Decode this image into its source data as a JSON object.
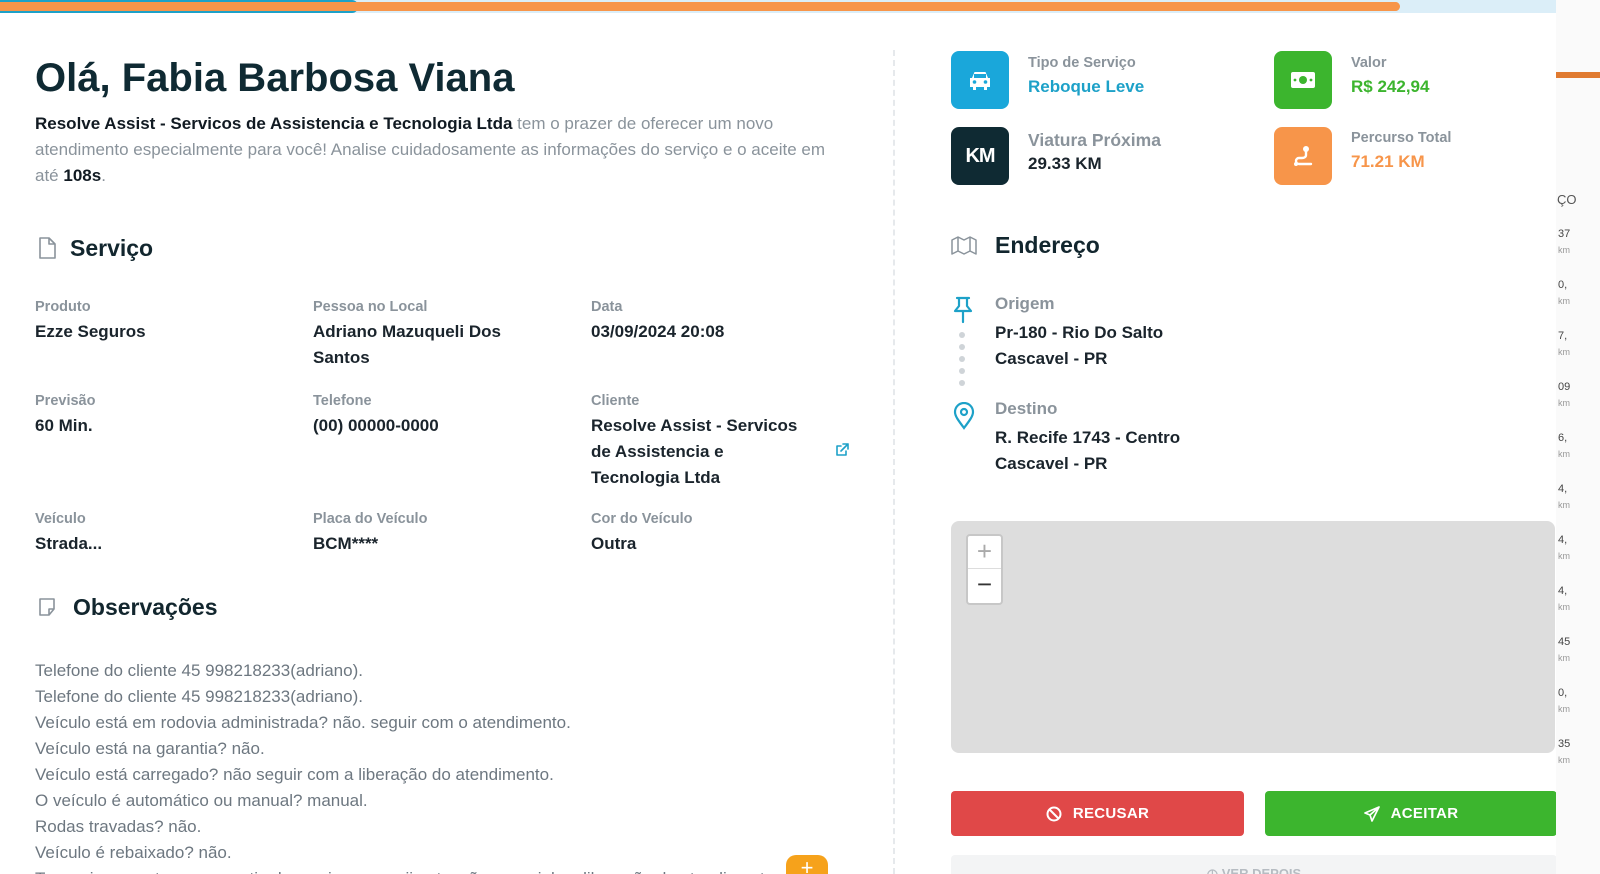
{
  "colors": {
    "accent_blue": "#1da1c8",
    "accent_orange": "#f7954a",
    "accent_green": "#3cb52e",
    "accent_red": "#e04848",
    "dark": "#0f2a33"
  },
  "progress": {
    "track_blue_fraction": 0.23,
    "orange_fraction": 0.9
  },
  "greeting": {
    "hello": "Olá,",
    "name": "Fabia Barbosa Viana",
    "company": "Resolve Assist - Servicos de Assistencia e Tecnologia Ltda",
    "text": "tem o prazer de oferecer um novo atendimento especialmente para você! Analise cuidadosamente as informações do serviço e o aceite em até",
    "timer": "108s",
    "end": "."
  },
  "service": {
    "title": "Serviço",
    "fields": [
      {
        "label": "Produto",
        "value": "Ezze Seguros"
      },
      {
        "label": "Pessoa no Local",
        "value": "Adriano Mazuqueli Dos Santos"
      },
      {
        "label": "Data",
        "value": "03/09/2024 20:08"
      },
      {
        "label": "Previsão",
        "value": "60 Min."
      },
      {
        "label": "Telefone",
        "value": "(00) 00000-0000"
      },
      {
        "label": "Cliente",
        "value": "Resolve Assist - Servicos de Assistencia e Tecnologia Ltda"
      },
      {
        "label": "Veículo",
        "value": "Strada..."
      },
      {
        "label": "Placa do Veículo",
        "value": "BCM****"
      },
      {
        "label": "Cor do Veículo",
        "value": "Outra"
      }
    ]
  },
  "observations": {
    "title": "Observações",
    "lines": [
      "Telefone do cliente 45 998218233(adriano).",
      "Telefone do cliente 45 998218233(adriano).",
      "Veículo está em rodovia administrada? não. seguir com o atendimento.",
      "Veículo está na garantia? não.",
      "Veículo está carregado? não seguir com a liberação do atendimento.",
      "O veículo é automático ou manual? manual.",
      "Rodas travadas? não.",
      "Veículo é rebaixado? não.",
      "Tem acionamentos na garantia do serviço que exija atenção especial na liberação do atendimento? não"
    ],
    "fab_label": "+"
  },
  "stats": {
    "service_type": {
      "label": "Tipo de Serviço",
      "value": "Reboque Leve",
      "color": "#1da1c8",
      "icon": "car-icon"
    },
    "price": {
      "label": "Valor",
      "value": "R$ 242,94",
      "color": "#3cb52e",
      "icon": "money-icon"
    },
    "nearest": {
      "label": "Viatura Próxima",
      "value": "29.33 KM",
      "color": "#1a242c",
      "icon": "km-icon",
      "icon_text": "KM"
    },
    "route": {
      "label": "Percurso Total",
      "value": "71.21 KM",
      "color": "#f7954a",
      "icon": "route-icon"
    }
  },
  "address": {
    "title": "Endereço",
    "origin": {
      "label": "Origem",
      "line1": "Pr-180 - Rio Do Salto",
      "line2": "Cascavel - PR"
    },
    "destination": {
      "label": "Destino",
      "line1": "R. Recife 1743 - Centro",
      "line2": "Cascavel - PR"
    }
  },
  "map": {
    "zoom_in": "+",
    "zoom_out": "−"
  },
  "actions": {
    "refuse": "RECUSAR",
    "accept": "ACEITAR",
    "later": "VER DEPOIS"
  },
  "background_app": {
    "title": "ÇO",
    "values": [
      "37",
      "0,",
      "7,",
      "09",
      "6,",
      "4,",
      "4,",
      "4,",
      "45",
      "0,",
      "35"
    ],
    "unit": "km"
  }
}
